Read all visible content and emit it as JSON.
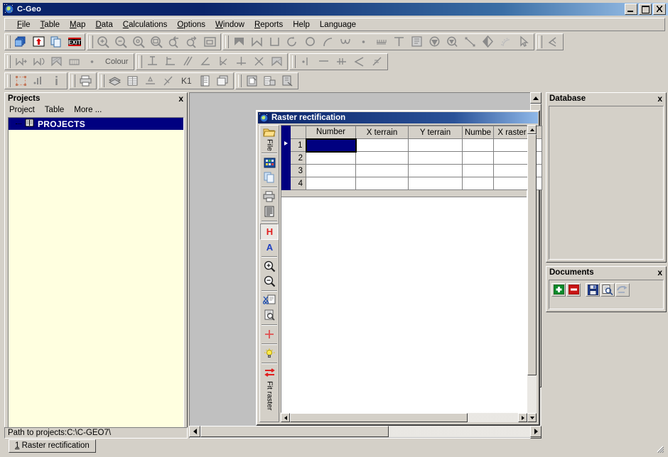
{
  "window": {
    "title": "C-Geo",
    "icon": "globe-icon",
    "controls": {
      "minimize": "minimize-button",
      "maximize": "maximize-button",
      "close": "close-button"
    }
  },
  "menu": [
    {
      "label": "File",
      "accel": "F"
    },
    {
      "label": "Table",
      "accel": "T"
    },
    {
      "label": "Map",
      "accel": "M"
    },
    {
      "label": "Data",
      "accel": "D"
    },
    {
      "label": "Calculations",
      "accel": "C"
    },
    {
      "label": "Options",
      "accel": "O"
    },
    {
      "label": "Window",
      "accel": "W"
    },
    {
      "label": "Reports",
      "accel": "R"
    },
    {
      "label": "Help",
      "accel": ""
    },
    {
      "label": "Language",
      "accel": ""
    }
  ],
  "toolbars": {
    "row1": {
      "group1": [
        "copy-windows-icon",
        "export-up-icon",
        "copy-page-icon",
        "exit-icon"
      ],
      "group2": [
        "zoom-in-icon",
        "zoom-out-icon",
        "zoom-window-icon",
        "zoom-extent-icon",
        "zoom-previous-icon",
        "zoom-next-icon",
        "zoom-fit-icon"
      ],
      "group3": [
        "polyline-fill-icon",
        "polyline-icon",
        "rectangle-icon",
        "arc-rotate-icon",
        "circle-icon",
        "arc-icon",
        "spline-icon",
        "point-icon",
        "dimension-icon",
        "text-icon",
        "note-icon",
        "fill-down-icon",
        "fill-search-icon",
        "line-measure-icon",
        "contrast-icon",
        "arc-dashed-icon",
        "pointer-icon"
      ],
      "group4": [
        "angle-tool-icon"
      ]
    },
    "row2": {
      "group1": [
        "poly-left-icon",
        "poly-right-icon",
        "hatch-icon",
        "grid-fill-icon",
        "point-dot-icon"
      ],
      "colour_label": "Colour",
      "group2": [
        "perpendicular-icon",
        "offset-icon",
        "parallel-icon",
        "angle-icon",
        "bisect-icon",
        "intersect-perp-icon",
        "cross-intersect-icon",
        "hatch-area-icon"
      ],
      "group3": [
        "point-line-icon",
        "equal-icon",
        "divide-icon",
        "arrow-left-icon",
        "strike-icon"
      ]
    },
    "row3": {
      "group1": [
        "select-area-icon",
        "chart-bars-icon",
        "info-icon"
      ],
      "group2": [
        "print-icon"
      ],
      "group3": [
        "layers-icon",
        "table-icon",
        "level-icon",
        "cross-line-icon"
      ],
      "k1_label": "K1",
      "group4": [
        "book-icon",
        "windows-stack-icon"
      ],
      "group5": [
        "edit-doc-icon",
        "import-doc-icon",
        "attach-doc-icon"
      ]
    }
  },
  "projects_panel": {
    "title": "Projects",
    "close": "x",
    "menu": [
      "Project",
      "Table",
      "More ..."
    ],
    "tree": [
      {
        "label": "PROJECTS",
        "icon": "book-open-icon",
        "selected": true
      }
    ]
  },
  "path_field": {
    "text": "Path to projects:C:\\C-GEO7\\"
  },
  "raster_window": {
    "title": "Raster rectification",
    "icon": "globe-icon",
    "vertical_toolbar": [
      {
        "name": "file-folder-icon",
        "label": "File"
      },
      {
        "name": "grid-colors-icon",
        "label": ""
      },
      {
        "name": "copy-icon",
        "label": ""
      },
      {
        "name": "print-icon",
        "label": ""
      },
      {
        "name": "report-lines-icon",
        "label": ""
      },
      {
        "name": "h-letter-icon",
        "label": "",
        "pressed": true
      },
      {
        "name": "a-letter-icon",
        "label": ""
      },
      {
        "name": "zoom-in-icon",
        "label": ""
      },
      {
        "name": "zoom-out-icon",
        "label": ""
      },
      {
        "name": "cut-paste-icon",
        "label": ""
      },
      {
        "name": "preview-icon",
        "label": ""
      },
      {
        "name": "crosshair-icon",
        "label": ""
      },
      {
        "name": "lightbulb-icon",
        "label": ""
      },
      {
        "name": "fit-raster-icon",
        "label": "Fit raster"
      }
    ],
    "grid": {
      "columns": [
        "Number",
        "X terrain",
        "Y terrain",
        "Numbe",
        "X raster",
        ""
      ],
      "rows": [
        {
          "num": "1",
          "cells": [
            "",
            "",
            "",
            "",
            "",
            ""
          ],
          "selected_cell": 0
        },
        {
          "num": "2",
          "cells": [
            "",
            "",
            "",
            "",
            "",
            ""
          ]
        },
        {
          "num": "3",
          "cells": [
            "",
            "",
            "",
            "",
            "",
            ""
          ]
        },
        {
          "num": "4",
          "cells": [
            "",
            "",
            "",
            "",
            "",
            ""
          ]
        }
      ]
    }
  },
  "database_panel": {
    "title": "Database",
    "close": "x"
  },
  "documents_panel": {
    "title": "Documents",
    "close": "x",
    "buttons": [
      "add-document-icon",
      "remove-document-icon",
      "save-document-icon",
      "preview-document-icon",
      "export-document-icon"
    ]
  },
  "taskbar": {
    "buttons": [
      {
        "label": "1 Raster rectification",
        "accel": "1"
      }
    ]
  },
  "colors": {
    "face": "#d4d0c8",
    "title_active": "#0a246a",
    "selection": "#000080",
    "tree_bg": "#ffffe0",
    "mdi_bg": "#c0c0c0",
    "icon_gray": "#808080",
    "accent_red": "#cc0000",
    "accent_green": "#008000"
  }
}
